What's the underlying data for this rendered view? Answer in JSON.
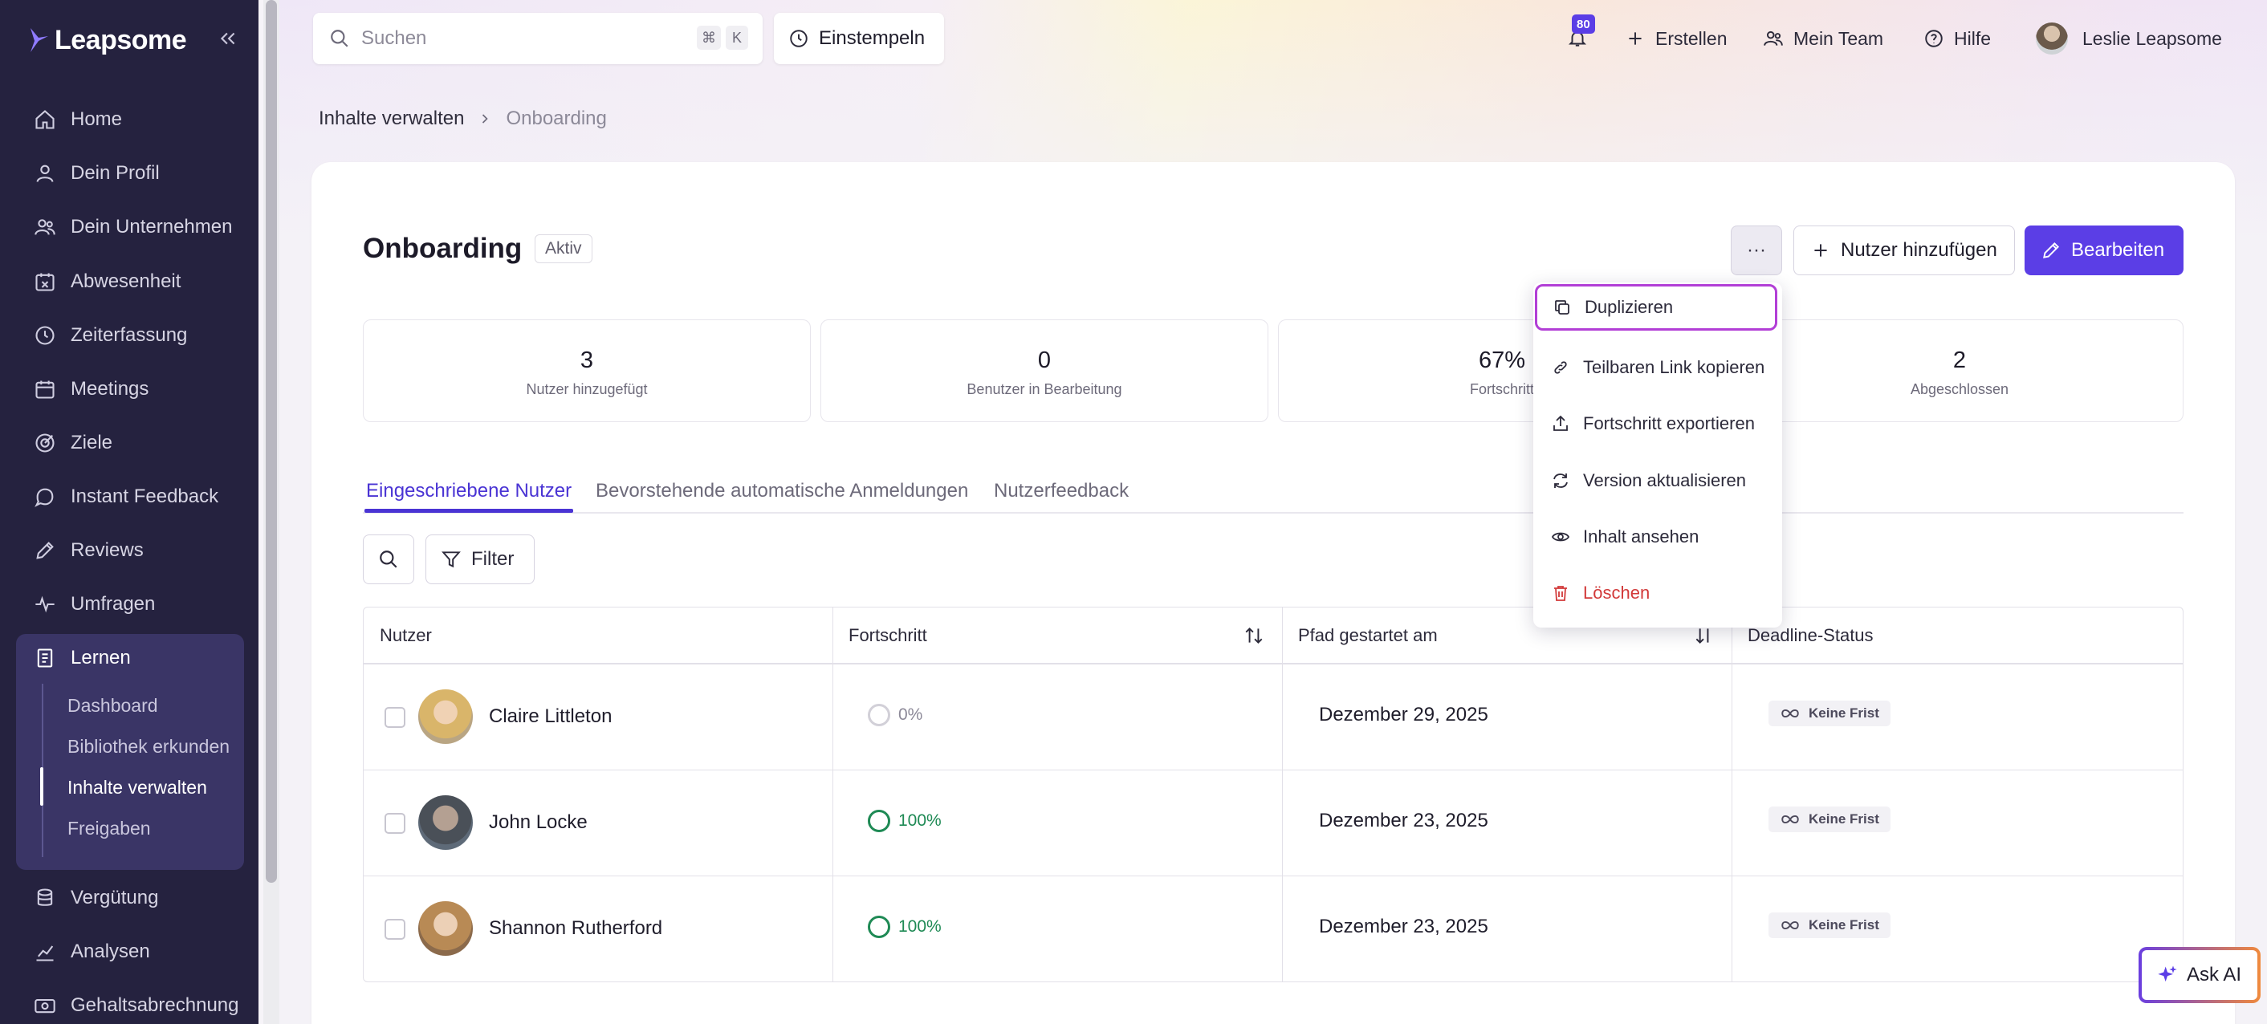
{
  "app": {
    "name": "Leapsome"
  },
  "sidebar": {
    "items": [
      {
        "label": "Home",
        "icon": "home-icon"
      },
      {
        "label": "Dein Profil",
        "icon": "user-icon"
      },
      {
        "label": "Dein Unternehmen",
        "icon": "users-icon"
      },
      {
        "label": "Abwesenheit",
        "icon": "calendar-x-icon"
      },
      {
        "label": "Zeiterfassung",
        "icon": "clock-icon"
      },
      {
        "label": "Meetings",
        "icon": "calendar-icon"
      },
      {
        "label": "Ziele",
        "icon": "target-icon"
      },
      {
        "label": "Instant Feedback",
        "icon": "chat-icon"
      },
      {
        "label": "Reviews",
        "icon": "pencil-icon"
      },
      {
        "label": "Umfragen",
        "icon": "pulse-icon"
      },
      {
        "label": "Lernen",
        "icon": "book-icon"
      },
      {
        "label": "Vergütung",
        "icon": "coins-icon"
      },
      {
        "label": "Analysen",
        "icon": "chart-icon"
      },
      {
        "label": "Gehaltsabrechnung",
        "icon": "money-icon"
      }
    ],
    "learn_subitems": [
      "Dashboard",
      "Bibliothek erkunden",
      "Inhalte verwalten",
      "Freigaben"
    ],
    "active_subitem": "Inhalte verwalten"
  },
  "topbar": {
    "search_placeholder": "Suchen",
    "shortcut_keys": [
      "⌘",
      "K"
    ],
    "clock_in_label": "Einstempeln",
    "notifications_count": "80",
    "create_label": "Erstellen",
    "team_label": "Mein Team",
    "help_label": "Hilfe",
    "user_name": "Leslie Leapsome"
  },
  "breadcrumb": {
    "parent": "Inhalte verwalten",
    "current": "Onboarding"
  },
  "page": {
    "title": "Onboarding",
    "status": "Aktiv",
    "more_label": "···",
    "add_user_label": "Nutzer hinzufügen",
    "edit_label": "Bearbeiten"
  },
  "stats": [
    {
      "value": "3",
      "label": "Nutzer hinzugefügt"
    },
    {
      "value": "0",
      "label": "Benutzer in Bearbeitung"
    },
    {
      "value": "67%",
      "label": "Fortschritt"
    },
    {
      "value": "2",
      "label": "Abgeschlossen"
    }
  ],
  "tabs": [
    "Eingeschriebene Nutzer",
    "Bevorstehende automatische Anmeldungen",
    "Nutzerfeedback"
  ],
  "active_tab": "Eingeschriebene Nutzer",
  "filter_label": "Filter",
  "table": {
    "columns": [
      "Nutzer",
      "Fortschritt",
      "Pfad gestartet am",
      "Deadline-Status"
    ],
    "rows": [
      {
        "name": "Claire Littleton",
        "progress": "0%",
        "started": "Dezember 29, 2025",
        "deadline": "Keine Frist"
      },
      {
        "name": "John Locke",
        "progress": "100%",
        "started": "Dezember 23, 2025",
        "deadline": "Keine Frist"
      },
      {
        "name": "Shannon Rutherford",
        "progress": "100%",
        "started": "Dezember 23, 2025",
        "deadline": "Keine Frist"
      }
    ]
  },
  "dropdown": {
    "items": [
      {
        "label": "Duplizieren",
        "icon": "copy-icon"
      },
      {
        "label": "Teilbaren Link kopieren",
        "icon": "link-icon"
      },
      {
        "label": "Fortschritt exportieren",
        "icon": "upload-icon"
      },
      {
        "label": "Version aktualisieren",
        "icon": "refresh-icon"
      },
      {
        "label": "Inhalt ansehen",
        "icon": "eye-icon"
      },
      {
        "label": "Löschen",
        "icon": "trash-icon"
      }
    ]
  },
  "ask_ai_label": "Ask AI",
  "colors": {
    "sidebar_bg": "#25223f",
    "accent": "#5b3ee6",
    "success": "#1f8a55",
    "danger": "#d23a3a"
  }
}
